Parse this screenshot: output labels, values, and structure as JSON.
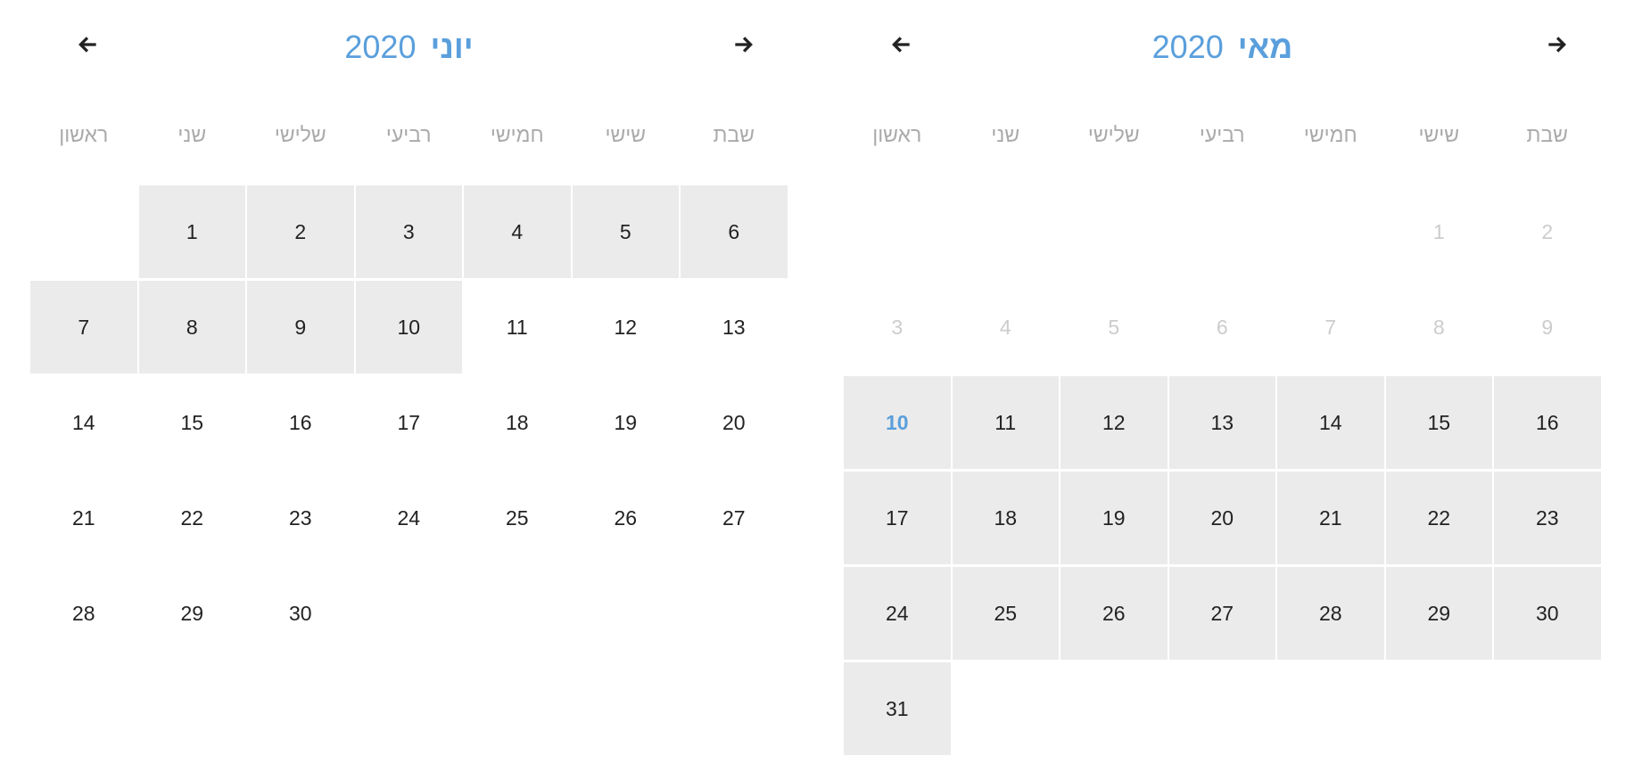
{
  "colors": {
    "accent": "#5a9fdc",
    "selected_bg": "#ebebeb",
    "text": "#222222",
    "disabled": "#cccccc",
    "weekday": "#aaaaaa"
  },
  "calendars": [
    {
      "month": "יוני",
      "year": "2020",
      "prev_icon": "arrow-left-icon",
      "next_icon": "arrow-right-icon",
      "weekdays": [
        "ראשון",
        "שני",
        "שלישי",
        "רביעי",
        "חמישי",
        "שישי",
        "שבת"
      ],
      "weeks": [
        [
          null,
          {
            "d": "1",
            "s": "sel"
          },
          {
            "d": "2",
            "s": "sel"
          },
          {
            "d": "3",
            "s": "sel"
          },
          {
            "d": "4",
            "s": "sel"
          },
          {
            "d": "5",
            "s": "sel"
          },
          {
            "d": "6",
            "s": "sel"
          }
        ],
        [
          {
            "d": "7",
            "s": "sel"
          },
          {
            "d": "8",
            "s": "sel"
          },
          {
            "d": "9",
            "s": "sel"
          },
          {
            "d": "10",
            "s": "sel"
          },
          {
            "d": "11"
          },
          {
            "d": "12"
          },
          {
            "d": "13"
          }
        ],
        [
          {
            "d": "14"
          },
          {
            "d": "15"
          },
          {
            "d": "16"
          },
          {
            "d": "17"
          },
          {
            "d": "18"
          },
          {
            "d": "19"
          },
          {
            "d": "20"
          }
        ],
        [
          {
            "d": "21"
          },
          {
            "d": "22"
          },
          {
            "d": "23"
          },
          {
            "d": "24"
          },
          {
            "d": "25"
          },
          {
            "d": "26"
          },
          {
            "d": "27"
          }
        ],
        [
          {
            "d": "28"
          },
          {
            "d": "29"
          },
          {
            "d": "30"
          },
          null,
          null,
          null,
          null
        ]
      ]
    },
    {
      "month": "מאי",
      "year": "2020",
      "prev_icon": "arrow-left-icon",
      "next_icon": "arrow-right-icon",
      "weekdays": [
        "ראשון",
        "שני",
        "שלישי",
        "רביעי",
        "חמישי",
        "שישי",
        "שבת"
      ],
      "weeks": [
        [
          null,
          null,
          null,
          null,
          null,
          {
            "d": "1",
            "s": "dis"
          },
          {
            "d": "2",
            "s": "dis"
          }
        ],
        [
          {
            "d": "3",
            "s": "dis"
          },
          {
            "d": "4",
            "s": "dis"
          },
          {
            "d": "5",
            "s": "dis"
          },
          {
            "d": "6",
            "s": "dis"
          },
          {
            "d": "7",
            "s": "dis"
          },
          {
            "d": "8",
            "s": "dis"
          },
          {
            "d": "9",
            "s": "dis"
          }
        ],
        [
          {
            "d": "10",
            "s": "sel today"
          },
          {
            "d": "11",
            "s": "sel"
          },
          {
            "d": "12",
            "s": "sel"
          },
          {
            "d": "13",
            "s": "sel"
          },
          {
            "d": "14",
            "s": "sel"
          },
          {
            "d": "15",
            "s": "sel"
          },
          {
            "d": "16",
            "s": "sel"
          }
        ],
        [
          {
            "d": "17",
            "s": "sel"
          },
          {
            "d": "18",
            "s": "sel"
          },
          {
            "d": "19",
            "s": "sel"
          },
          {
            "d": "20",
            "s": "sel"
          },
          {
            "d": "21",
            "s": "sel"
          },
          {
            "d": "22",
            "s": "sel"
          },
          {
            "d": "23",
            "s": "sel"
          }
        ],
        [
          {
            "d": "24",
            "s": "sel"
          },
          {
            "d": "25",
            "s": "sel"
          },
          {
            "d": "26",
            "s": "sel"
          },
          {
            "d": "27",
            "s": "sel"
          },
          {
            "d": "28",
            "s": "sel"
          },
          {
            "d": "29",
            "s": "sel"
          },
          {
            "d": "30",
            "s": "sel"
          }
        ],
        [
          {
            "d": "31",
            "s": "sel"
          },
          null,
          null,
          null,
          null,
          null,
          null
        ]
      ]
    }
  ]
}
